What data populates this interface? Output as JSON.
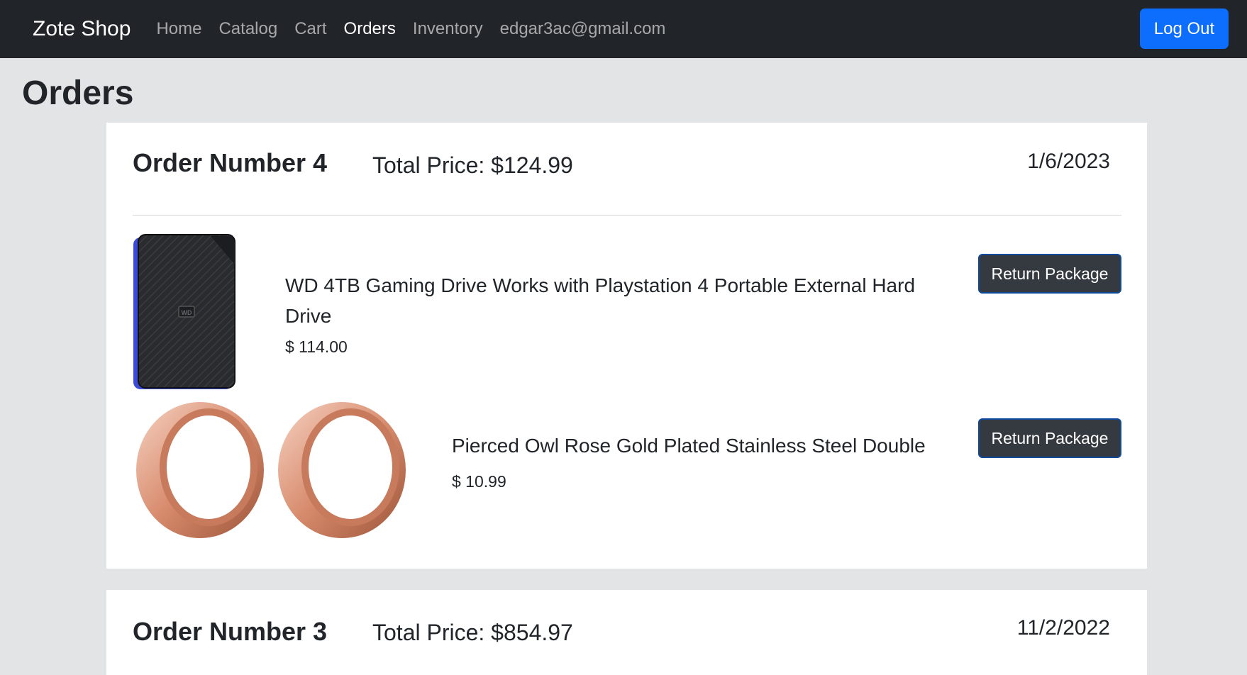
{
  "navbar": {
    "brand": "Zote Shop",
    "links": [
      "Home",
      "Catalog",
      "Cart",
      "Orders",
      "Inventory"
    ],
    "email": "edgar3ac@gmail.com",
    "logout_label": "Log Out"
  },
  "page": {
    "title": "Orders"
  },
  "orders": [
    {
      "title": "Order Number 4",
      "total": "Total Price: $124.99",
      "date": "1/6/2023",
      "items": [
        {
          "name": "WD 4TB Gaming Drive Works with Playstation 4 Portable External Hard Drive",
          "price": "$ 114.00",
          "button": "Return Package"
        },
        {
          "name": "Pierced Owl Rose Gold Plated Stainless Steel Double",
          "price": "$ 10.99",
          "button": "Return Package"
        }
      ]
    },
    {
      "title": "Order Number 3",
      "total": "Total Price: $854.97",
      "date": "11/2/2022"
    }
  ],
  "colors": {
    "navbar_bg": "#212529",
    "primary": "#0d6efd",
    "page_bg": "#e3e4e5",
    "dark_button": "#343a40"
  }
}
